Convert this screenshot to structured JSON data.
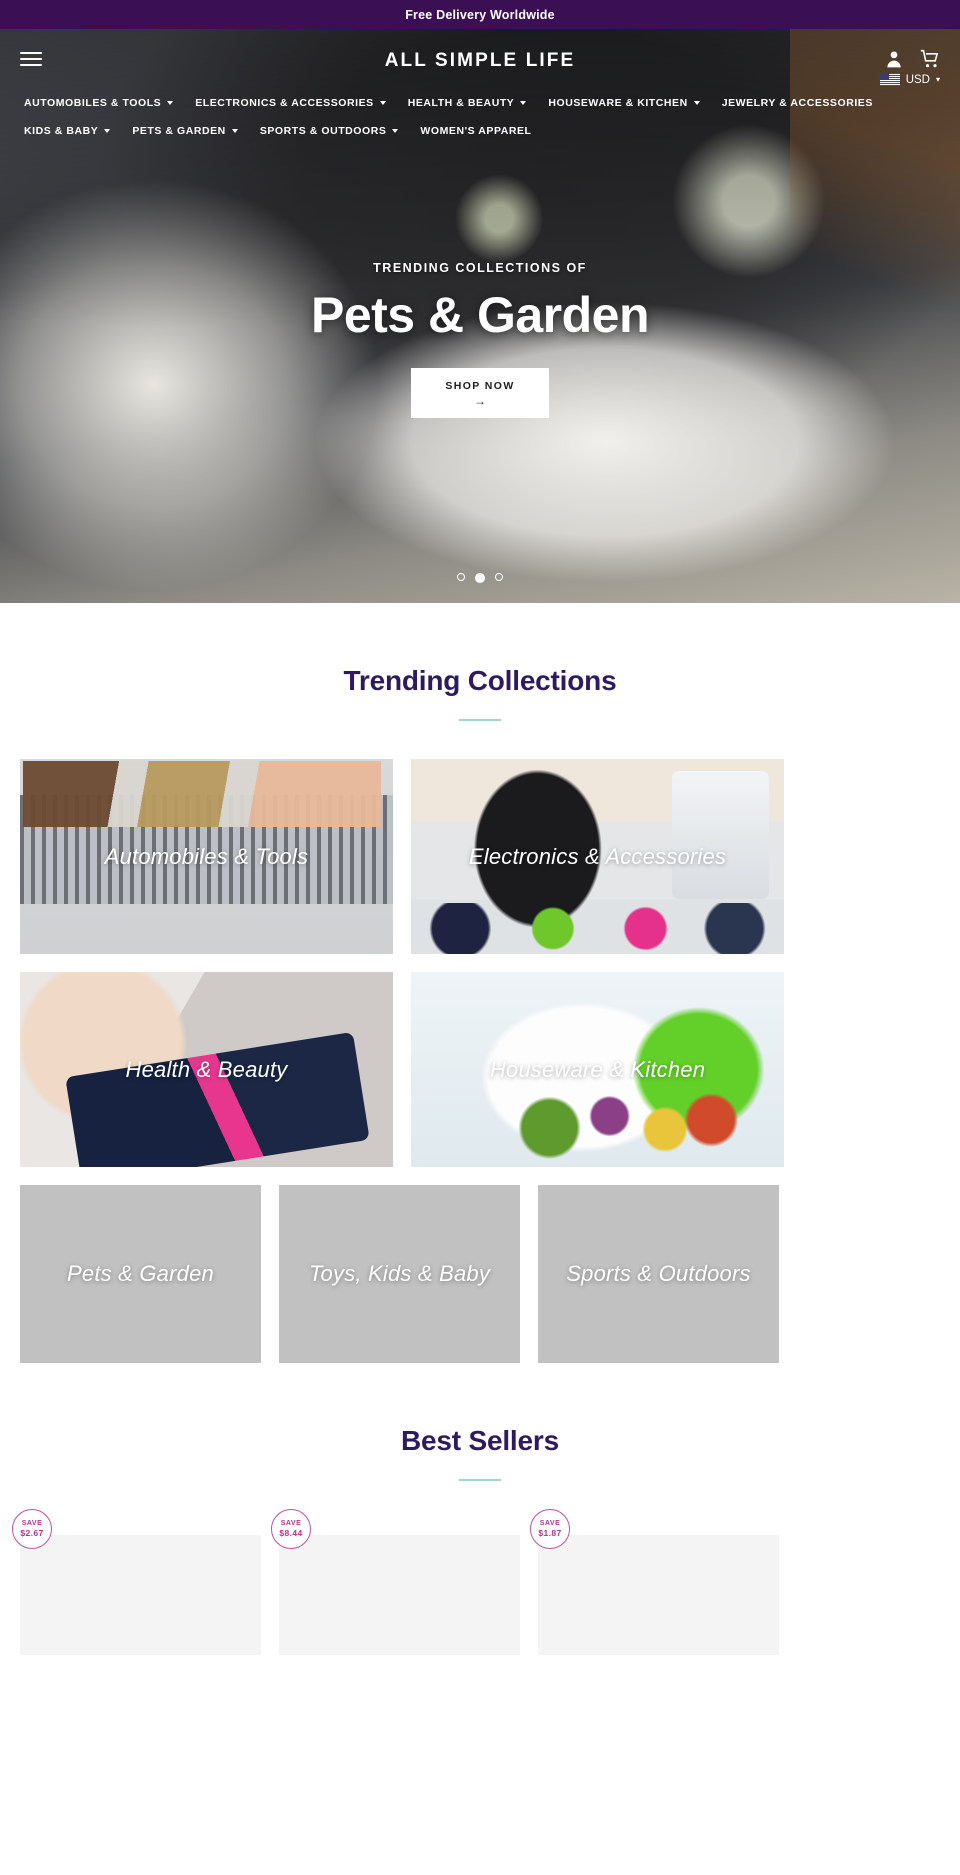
{
  "announcement": {
    "text": "Free Delivery Worldwide"
  },
  "header": {
    "brand": "ALL SIMPLE LIFE",
    "menu_icon": "hamburger-icon",
    "account_icon": "person-icon",
    "cart_icon": "cart-icon",
    "currency": {
      "code": "USD",
      "flag": "us-flag-icon",
      "caret": "▾"
    }
  },
  "nav": {
    "items": [
      {
        "label": "AUTOMOBILES & TOOLS",
        "has_dropdown": true
      },
      {
        "label": "ELECTRONICS & ACCESSORIES",
        "has_dropdown": true
      },
      {
        "label": "HEALTH & BEAUTY",
        "has_dropdown": true
      },
      {
        "label": "HOUSEWARE & KITCHEN",
        "has_dropdown": true
      },
      {
        "label": "JEWELRY & ACCESSORIES",
        "has_dropdown": false
      },
      {
        "label": "KIDS & BABY",
        "has_dropdown": true
      },
      {
        "label": "PETS & GARDEN",
        "has_dropdown": true
      },
      {
        "label": "SPORTS & OUTDOORS",
        "has_dropdown": true
      },
      {
        "label": "WOMEN'S APPAREL",
        "has_dropdown": false
      }
    ]
  },
  "hero": {
    "kicker": "TRENDING COLLECTIONS OF",
    "title": "Pets & Garden",
    "cta_label": "SHOP NOW",
    "cta_arrow": "→",
    "slides_total": 3,
    "active_slide": 2
  },
  "trending": {
    "title": "Trending Collections",
    "tiles": [
      {
        "label": "Automobiles & Tools",
        "size": "half",
        "art": "art-tools"
      },
      {
        "label": "Electronics & Accessories",
        "size": "half",
        "art": "art-elec"
      },
      {
        "label": "Health & Beauty",
        "size": "half",
        "art": "art-beauty"
      },
      {
        "label": "Houseware & Kitchen",
        "size": "half",
        "art": "art-kitchen"
      },
      {
        "label": "Pets & Garden",
        "size": "third",
        "art": ""
      },
      {
        "label": "Toys, Kids & Baby",
        "size": "third",
        "art": ""
      },
      {
        "label": "Sports & Outdoors",
        "size": "third",
        "art": ""
      }
    ]
  },
  "best_sellers": {
    "title": "Best Sellers",
    "products": [
      {
        "save_word": "SAVE",
        "save_amount": "$2.67"
      },
      {
        "save_word": "SAVE",
        "save_amount": "$8.44"
      },
      {
        "save_word": "SAVE",
        "save_amount": "$1.87"
      }
    ]
  },
  "colors": {
    "announce_bg": "#3b0f54",
    "heading": "#2e1a5e",
    "rule": "#a9d4d6",
    "badge": "#b8308c"
  }
}
